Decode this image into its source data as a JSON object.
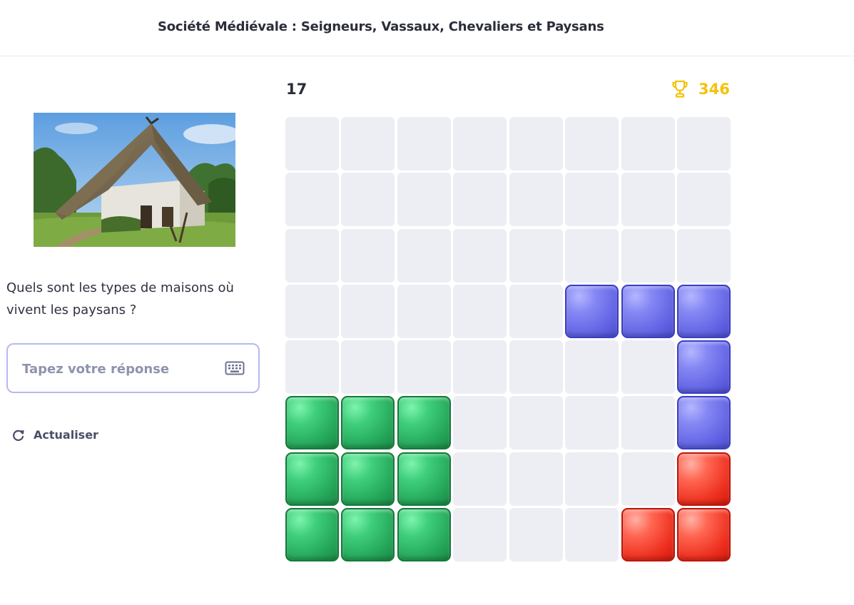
{
  "header": {
    "title": "Société Médiévale : Seigneurs, Vassaux, Chevaliers et Paysans"
  },
  "question": {
    "image_alt": "peasant-thatched-house-photo",
    "text": "Quels sont les types de maisons où vivent les paysans ?"
  },
  "answer": {
    "placeholder": "Tapez votre réponse",
    "value": "",
    "icon": "keyboard-icon"
  },
  "refresh": {
    "label": "Actualiser",
    "icon": "refresh-icon"
  },
  "game": {
    "level": "17",
    "score": "346",
    "score_icon": "trophy-icon",
    "board_rows": 8,
    "board_cols": 8,
    "board": [
      [
        "empty",
        "empty",
        "empty",
        "empty",
        "empty",
        "empty",
        "empty",
        "empty"
      ],
      [
        "empty",
        "empty",
        "empty",
        "empty",
        "empty",
        "empty",
        "empty",
        "empty"
      ],
      [
        "empty",
        "empty",
        "empty",
        "empty",
        "empty",
        "empty",
        "empty",
        "empty"
      ],
      [
        "empty",
        "empty",
        "empty",
        "empty",
        "empty",
        "blue",
        "blue",
        "blue"
      ],
      [
        "empty",
        "empty",
        "empty",
        "empty",
        "empty",
        "empty",
        "empty",
        "blue"
      ],
      [
        "green",
        "green",
        "green",
        "empty",
        "empty",
        "empty",
        "empty",
        "blue"
      ],
      [
        "green",
        "green",
        "green",
        "empty",
        "empty",
        "empty",
        "empty",
        "red"
      ],
      [
        "green",
        "green",
        "green",
        "empty",
        "empty",
        "empty",
        "red",
        "red"
      ]
    ]
  },
  "colors": {
    "score": "#f4c20d",
    "input_border": "#b6b9ee",
    "empty_cell": "#eceef3",
    "green_block": "#2fbf6a",
    "blue_block": "#6b6df0",
    "red_block": "#f23a26"
  }
}
